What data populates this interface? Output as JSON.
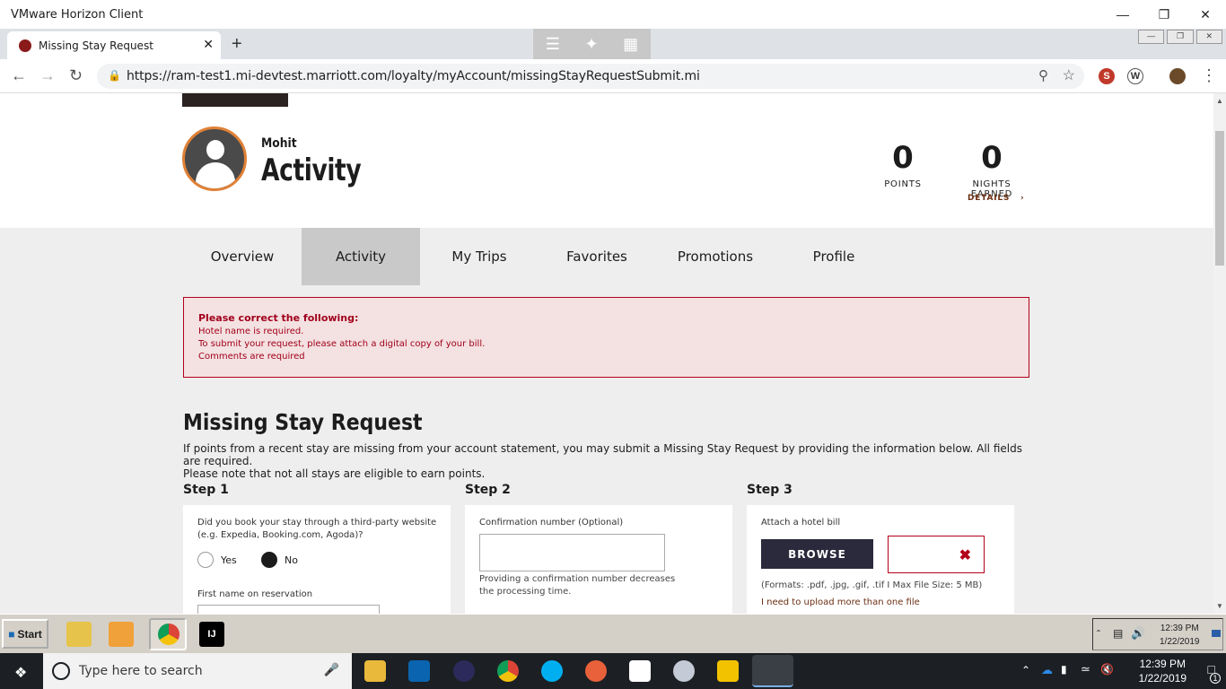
{
  "window": {
    "title": "VMware Horizon Client"
  },
  "browser": {
    "tab_title": "Missing Stay Request",
    "url": "https://ram-test1.mi-devtest.marriott.com/loyalty/myAccount/missingStayRequestSubmit.mi"
  },
  "header": {
    "user_name": "Mohit",
    "page_title": "Activity",
    "points_value": "0",
    "points_label": "POINTS",
    "nights_value": "0",
    "nights_label": "NIGHTS EARNED",
    "details_label": "DETAILS"
  },
  "nav": {
    "tabs": [
      {
        "label": "Overview"
      },
      {
        "label": "Activity"
      },
      {
        "label": "My Trips"
      },
      {
        "label": "Favorites"
      },
      {
        "label": "Promotions"
      },
      {
        "label": "Profile"
      }
    ],
    "active": "Activity"
  },
  "errors": {
    "heading": "Please correct the following:",
    "items": [
      "Hotel name is required.",
      "To submit your request, please attach a digital copy of your bill.",
      "Comments are required"
    ]
  },
  "missing_stay": {
    "title": "Missing Stay Request",
    "description_line1": "If points from a recent stay are missing from your account statement, you may submit a Missing Stay Request by providing the information below. All fields are required.",
    "description_line2": "Please note that not all stays are eligible to earn points.",
    "step1": {
      "heading": "Step 1",
      "question_line1": "Did you book your stay through a third-party website",
      "question_line2": "(e.g. Expedia, Booking.com, Agoda)?",
      "yes_label": "Yes",
      "no_label": "No",
      "selected": "No",
      "first_name_label": "First name on reservation"
    },
    "step2": {
      "heading": "Step 2",
      "confirmation_label": "Confirmation number (Optional)",
      "confirmation_value": "",
      "help_line1": "Providing a confirmation number decreases",
      "help_line2": "the processing time."
    },
    "step3": {
      "heading": "Step 3",
      "attach_label": "Attach a hotel bill",
      "browse_label": "BROWSE",
      "formats_text": "(Formats: .pdf, .jpg, .gif, .tif I Max File Size: 5 MB)",
      "more_files_link": "I need to upload more than one file"
    }
  },
  "vm_taskbar": {
    "start_label": "Start",
    "time": "12:39 PM",
    "date": "1/22/2019"
  },
  "win_taskbar": {
    "search_placeholder": "Type here to search",
    "time": "12:39 PM",
    "date": "1/22/2019",
    "notification_count": "1"
  },
  "colors": {
    "avatar_ring": "#e08136",
    "error_text": "#a1001b",
    "error_bg": "#f4e1e1",
    "active_tab_bg": "#c9c9c9",
    "browse_bg": "#2a2a3c"
  }
}
